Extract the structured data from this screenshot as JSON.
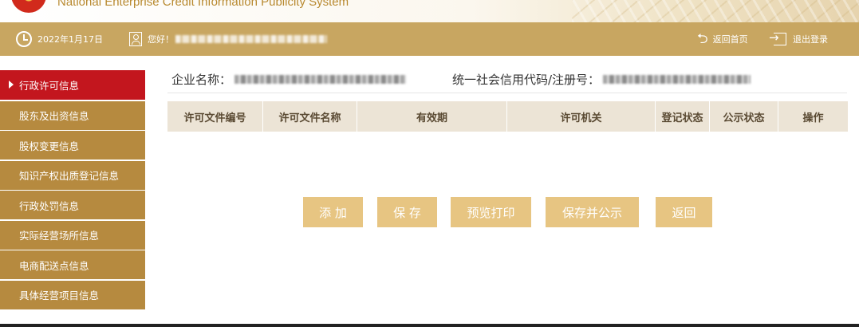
{
  "banner": {
    "site_title": "National Enterprise Credit Information Publicity System"
  },
  "status_bar": {
    "date": "2022年1月17日",
    "greeting": "您好！",
    "back_home": "返回首页",
    "logout": "退出登录"
  },
  "sidebar": {
    "items": [
      {
        "label": "行政许可信息",
        "active": true
      },
      {
        "label": "股东及出资信息",
        "active": false
      },
      {
        "label": "股权变更信息",
        "active": false
      },
      {
        "label": "知识产权出质登记信息",
        "active": false
      },
      {
        "label": "行政处罚信息",
        "active": false
      },
      {
        "label": "实际经营场所信息",
        "active": false
      },
      {
        "label": "电商配送点信息",
        "active": false
      },
      {
        "label": "具体经营项目信息",
        "active": false
      }
    ]
  },
  "main": {
    "company_name_label": "企业名称：",
    "credit_code_label": "统一社会信用代码/注册号：",
    "table": {
      "columns": [
        "许可文件编号",
        "许可文件名称",
        "有效期",
        "许可机关",
        "登记状态",
        "公示状态",
        "操作"
      ],
      "rows": []
    },
    "buttons": {
      "add": "添 加",
      "save": "保 存",
      "preview_print": "预览打印",
      "save_publish": "保存并公示",
      "back": "返回"
    }
  },
  "colors": {
    "gold_bar": "#c8a661",
    "sidebar_item": "#b68a3f",
    "sidebar_active": "#c3161e",
    "table_header": "#ece4d6",
    "button": "#e7c582"
  }
}
